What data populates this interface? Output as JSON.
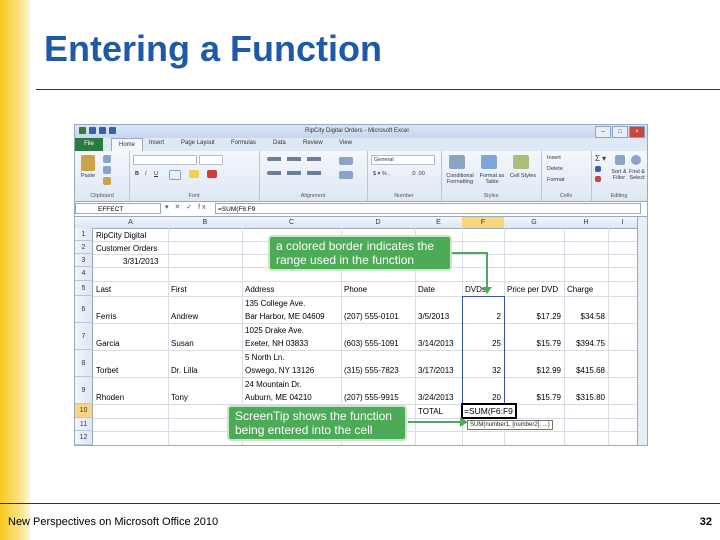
{
  "slide": {
    "title": "Entering a Function",
    "footer": "New Perspectives on Microsoft Office 2010",
    "page_number": "32"
  },
  "excel": {
    "window_title": "RipCity Digital Orders  -  Microsoft Excel",
    "window_buttons": [
      "–",
      "□",
      "×"
    ],
    "tabs": [
      "File",
      "Home",
      "Insert",
      "Page Layout",
      "Formulas",
      "Data",
      "Review",
      "View"
    ],
    "ribbon": {
      "groups": [
        "Clipboard",
        "Font",
        "Alignment",
        "Number",
        "Styles",
        "Cells",
        "Editing"
      ],
      "paste_label": "Paste",
      "number_format": "General",
      "cells_buttons": [
        "Insert",
        "Delete",
        "Format"
      ],
      "styles_buttons": [
        "Conditional Formatting",
        "Format as Table",
        "Cell Styles"
      ],
      "editing_buttons": [
        "Sort & Filter",
        "Find & Select"
      ]
    },
    "name_box": "EFFECT",
    "formula_bar_icons": "▾ ✕ ✓ fx",
    "formula": "=SUM(F6:F9",
    "columns": [
      "A",
      "B",
      "C",
      "D",
      "E",
      "F",
      "G",
      "H",
      "I"
    ],
    "rows": [
      "1",
      "2",
      "3",
      "4",
      "5",
      "6",
      "7",
      "8",
      "9",
      "10",
      "11",
      "12"
    ],
    "cells": {
      "A1": "RipCity Digital",
      "A2": "Customer Orders",
      "A3": "3/31/2013",
      "A5": "Last",
      "B5": "First",
      "C5": "Address",
      "D5": "Phone",
      "E5": "Date",
      "F5": "DVDs",
      "G5": "Price per DVD",
      "H5": "Charge",
      "A6": "Ferris",
      "B6": "Andrew",
      "C6a": "135 College Ave.",
      "C6b": "Bar Harbor, ME 04609",
      "D6": "(207) 555-0101",
      "E6": "3/5/2013",
      "F6": "2",
      "G6": "$17.29",
      "H6": "$34.58",
      "A7": "Garcia",
      "B7": "Susan",
      "C7a": "1025 Drake Ave.",
      "C7b": "Exeter, NH 03833",
      "D7": "(603) 555-1091",
      "E7": "3/14/2013",
      "F7": "25",
      "G7": "$15.79",
      "H7": "$394.75",
      "A8": "Torbet",
      "B8": "Dr. Lilla",
      "C8a": "5 North Ln.",
      "C8b": "Oswego, NY 13126",
      "D8": "(315) 555-7823",
      "E8": "3/17/2013",
      "F8": "32",
      "G8": "$12.99",
      "H8": "$415.68",
      "A9": "Rhoden",
      "B9": "Tony",
      "C9a": "24 Mountain Dr.",
      "C9b": "Auburn, ME 04210",
      "D9": "(207) 555-9915",
      "E9": "3/24/2013",
      "F9": "20",
      "G9": "$15.79",
      "H9": "$315.80",
      "E10": "TOTAL",
      "F10": "=SUM(F6:F9"
    },
    "screentip": "SUM(number1, [number2], ...)"
  },
  "callouts": {
    "border": "a colored border indicates the range used in the function",
    "screentip": "ScreenTip shows the function being entered into the cell"
  },
  "colors": {
    "title": "#1f5aa6",
    "callout_bg": "#4daa57",
    "range_border": "#2f55a4",
    "file_tab": "#2c7a3f"
  }
}
